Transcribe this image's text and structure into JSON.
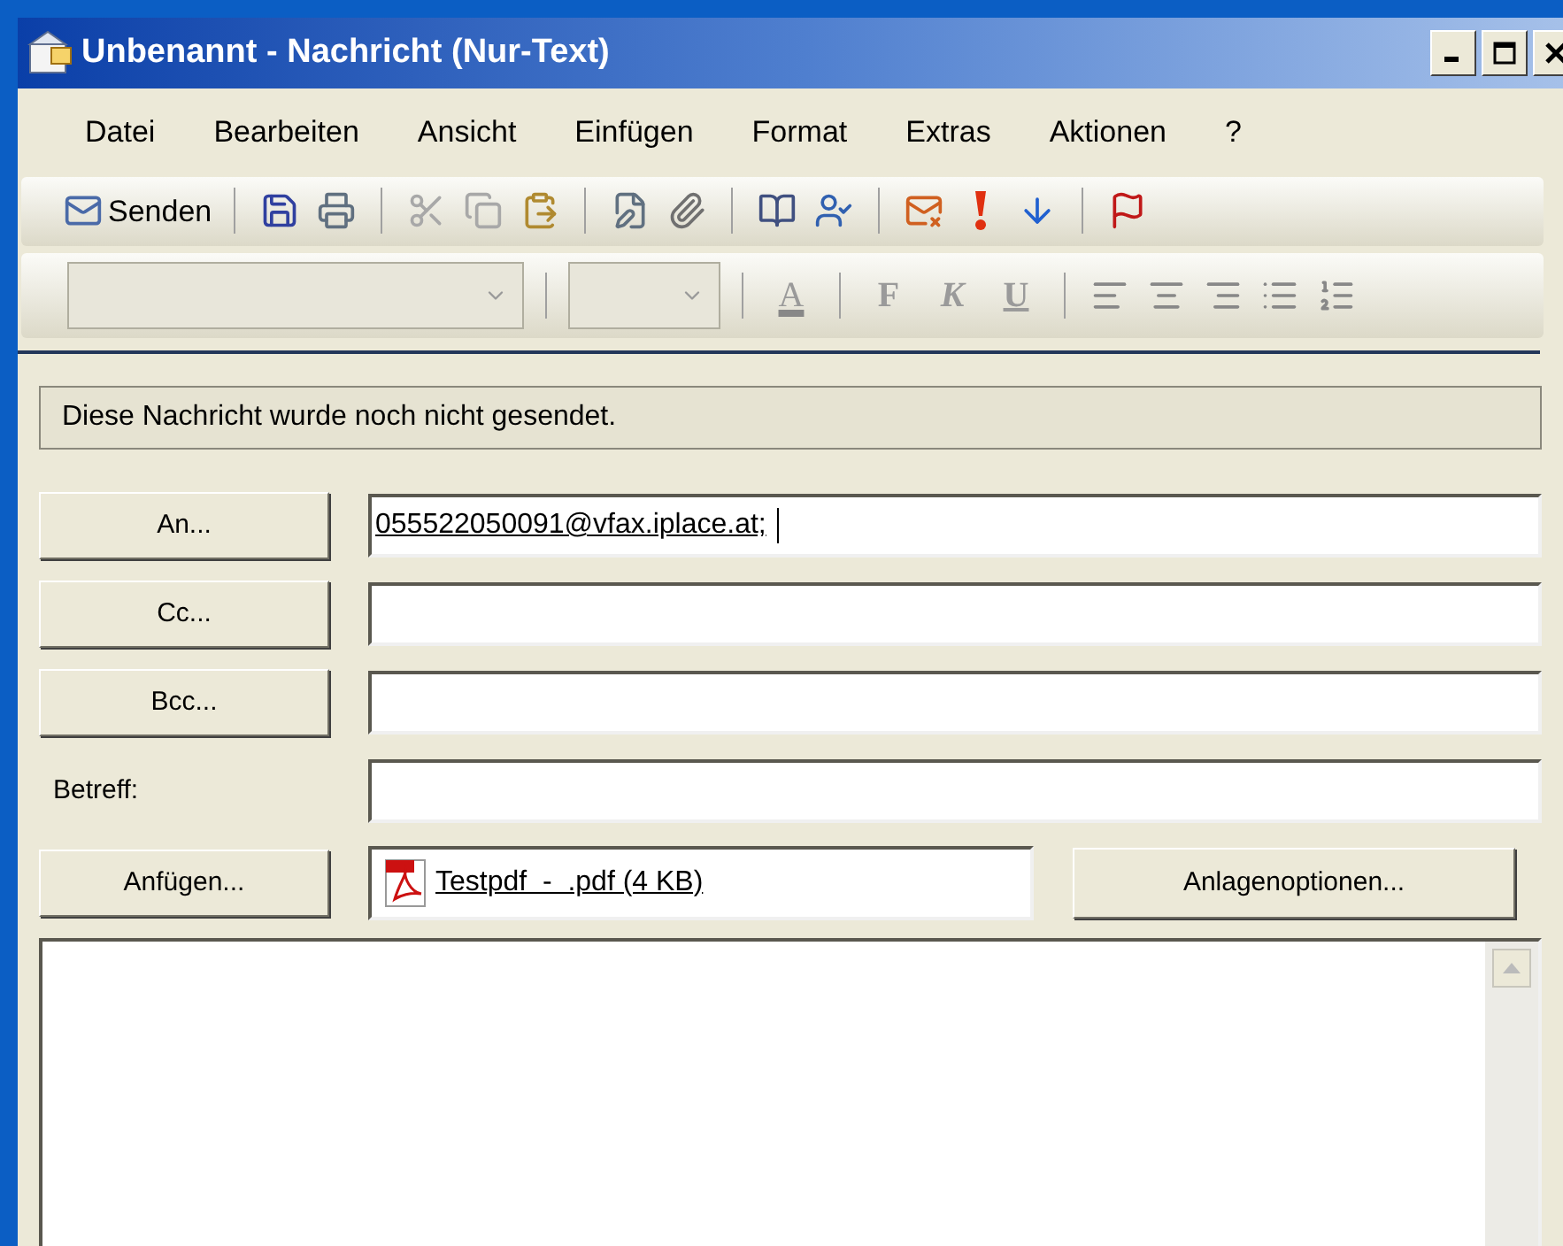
{
  "window": {
    "title": "Unbenannt - Nachricht (Nur-Text)"
  },
  "menu": [
    "Datei",
    "Bearbeiten",
    "Ansicht",
    "Einfügen",
    "Format",
    "Extras",
    "Aktionen",
    "?"
  ],
  "toolbar": {
    "send_label": "Senden"
  },
  "format_toolbar": {
    "letters": [
      {
        "kind": "color",
        "text": "A"
      },
      {
        "kind": "bold",
        "text": "F"
      },
      {
        "kind": "italic",
        "text": "K"
      },
      {
        "kind": "underline",
        "text": "U"
      }
    ]
  },
  "info_bar": "Diese Nachricht wurde noch nicht gesendet.",
  "fields": [
    {
      "kind": "button",
      "label": "An...",
      "value": "055522050091@vfax.iplace.at;",
      "focused": true
    },
    {
      "kind": "button",
      "label": "Cc...",
      "focused": false
    },
    {
      "kind": "button",
      "label": "Bcc...",
      "focused": false
    },
    {
      "kind": "label",
      "label": "Betreff:",
      "focused": false
    }
  ],
  "attachments": {
    "button": "Anfügen...",
    "file": "Testpdf  -  .pdf (4 KB)",
    "options_button": "Anlagenoptionen..."
  }
}
